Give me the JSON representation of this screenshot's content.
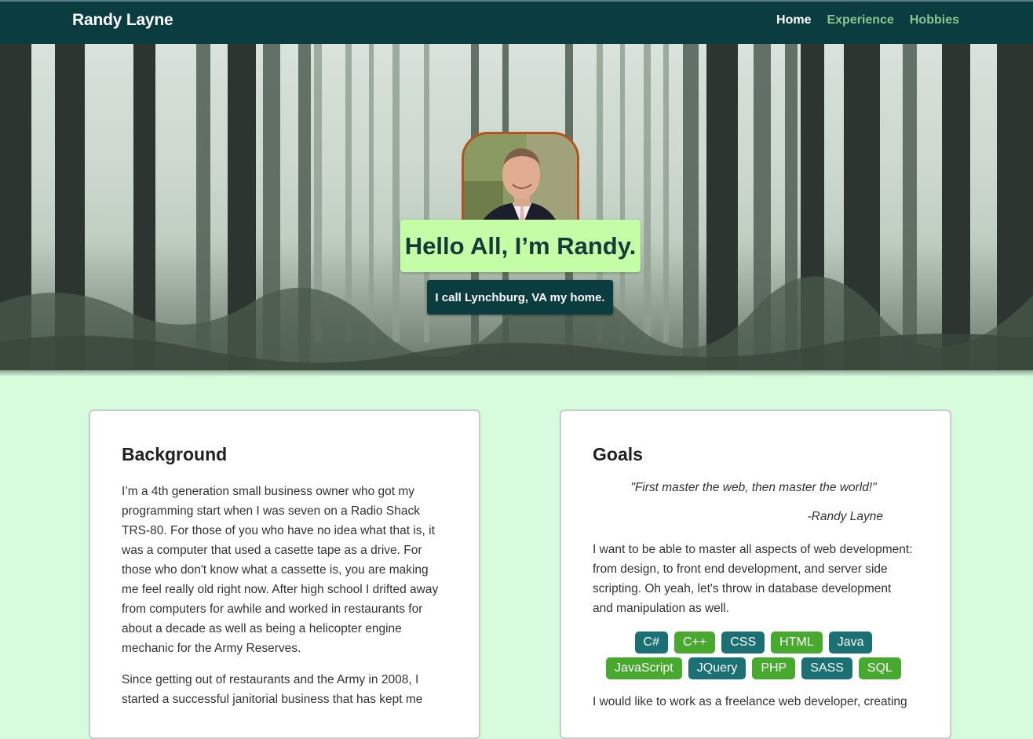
{
  "nav": {
    "brand": "Randy Layne",
    "links": [
      {
        "label": "Home",
        "active": true
      },
      {
        "label": "Experience",
        "active": false
      },
      {
        "label": "Hobbies",
        "active": false
      }
    ]
  },
  "hero": {
    "greeting": "Hello All, I’m Randy.",
    "location": "I call Lynchburg, VA my home."
  },
  "background": {
    "title": "Background",
    "paragraphs": [
      "I’m a 4th generation small business owner who got my programming start when I was seven on a Radio Shack TRS-80. For those of you who have no idea what that is, it was a computer that used a casette tape as a drive. For those who don't know what a cassette is, you are making me feel really old right now. After high school I drifted away from computers for awhile and worked in restaurants for about a decade as well as being a helicopter engine mechanic for the Army Reserves.",
      "Since getting out of restaurants and the Army in 2008, I started a successful janitorial business that has kept me"
    ]
  },
  "goals": {
    "title": "Goals",
    "quote": "\"First master the web, then master the world!\"",
    "quote_author": "-Randy Layne",
    "paragraph1": "I want to be able to master all aspects of web development: from design, to front end development, and server side scripting. Oh yeah, let's throw in database development and manipulation as well.",
    "tags": [
      {
        "label": "C#",
        "color": "teal"
      },
      {
        "label": "C++",
        "color": "green"
      },
      {
        "label": "CSS",
        "color": "teal"
      },
      {
        "label": "HTML",
        "color": "green"
      },
      {
        "label": "Java",
        "color": "teal"
      },
      {
        "label": "JavaScript",
        "color": "green"
      },
      {
        "label": "JQuery",
        "color": "teal"
      },
      {
        "label": "PHP",
        "color": "green"
      },
      {
        "label": "SASS",
        "color": "teal"
      },
      {
        "label": "SQL",
        "color": "green"
      }
    ],
    "paragraph2": "I would like to work as a freelance web developer, creating"
  },
  "colors": {
    "navbar": "#0b3c3f",
    "page_background": "#d6fcdd",
    "hello_box": "#c5fca6",
    "tag_teal": "#1b7073",
    "tag_green": "#47aa2f",
    "avatar_border": "#b4531e"
  }
}
